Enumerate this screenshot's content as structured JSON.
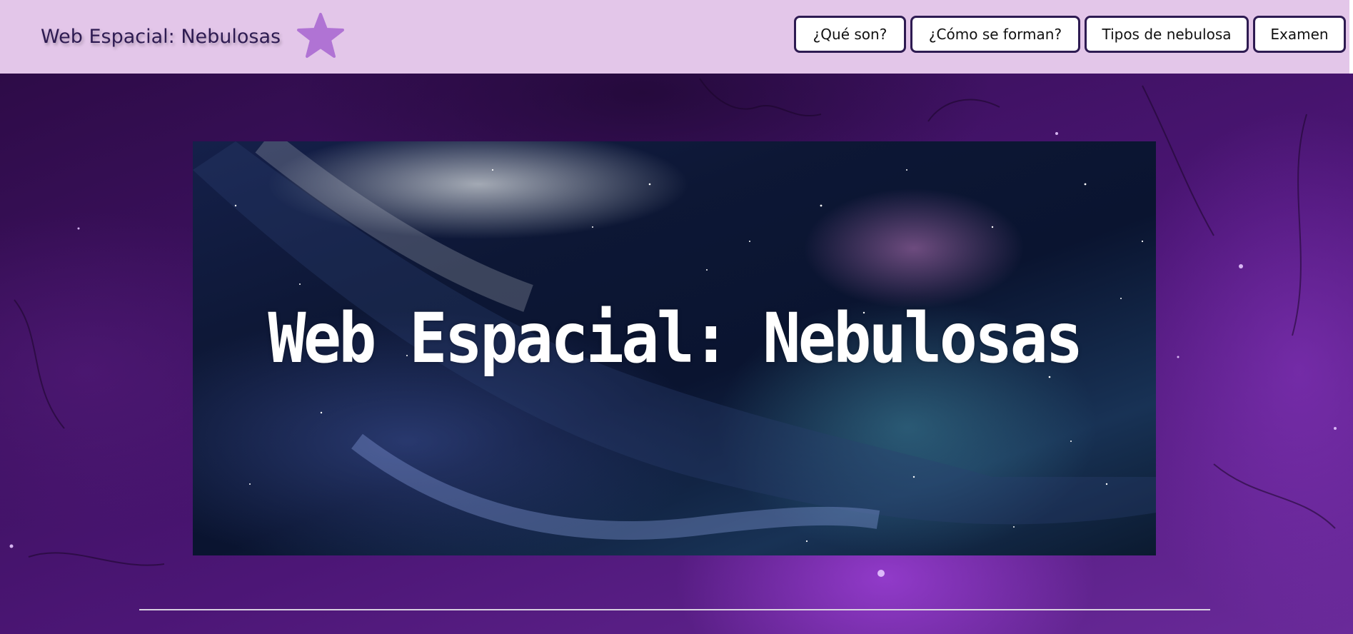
{
  "header": {
    "brand": "Web Espacial: Nebulosas",
    "brand_icon": "star-icon",
    "nav": [
      {
        "label": "¿Qué son?"
      },
      {
        "label": "¿Cómo se forman?"
      },
      {
        "label": "Tipos de nebulosa"
      },
      {
        "label": "Examen"
      }
    ]
  },
  "hero": {
    "title": "Web Espacial: Nebulosas"
  },
  "colors": {
    "navbar_bg": "#e3c6e9",
    "brand_text": "#2e1b52",
    "star": "#b073d4",
    "button_border": "#2e1b52",
    "page_bg": "#3c1258"
  }
}
